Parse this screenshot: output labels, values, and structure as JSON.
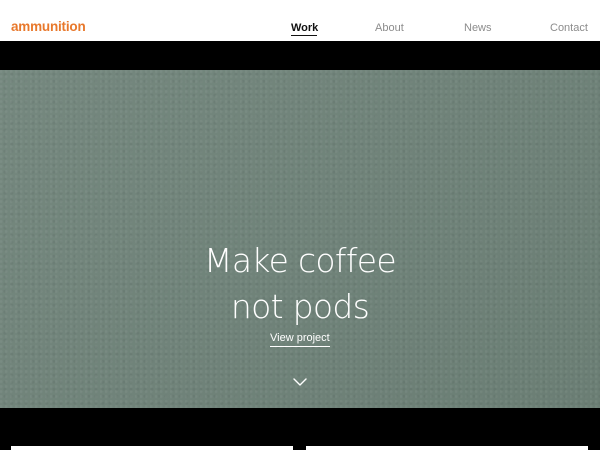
{
  "header": {
    "logo": "ammunition",
    "nav": [
      {
        "label": "Work",
        "active": true
      },
      {
        "label": "About",
        "active": false
      },
      {
        "label": "News",
        "active": false
      },
      {
        "label": "Contact",
        "active": false
      }
    ]
  },
  "hero": {
    "title_line1": "Make coffee",
    "title_line2": "not pods",
    "cta_label": "View project",
    "scroll_icon": "chevron-down-icon",
    "background_color": "#6f8379"
  },
  "colors": {
    "brand": "#e8782b",
    "header_bg": "#ffffff",
    "nav_inactive": "#8c8c8c",
    "nav_active": "#111111",
    "page_bg": "#000000"
  }
}
